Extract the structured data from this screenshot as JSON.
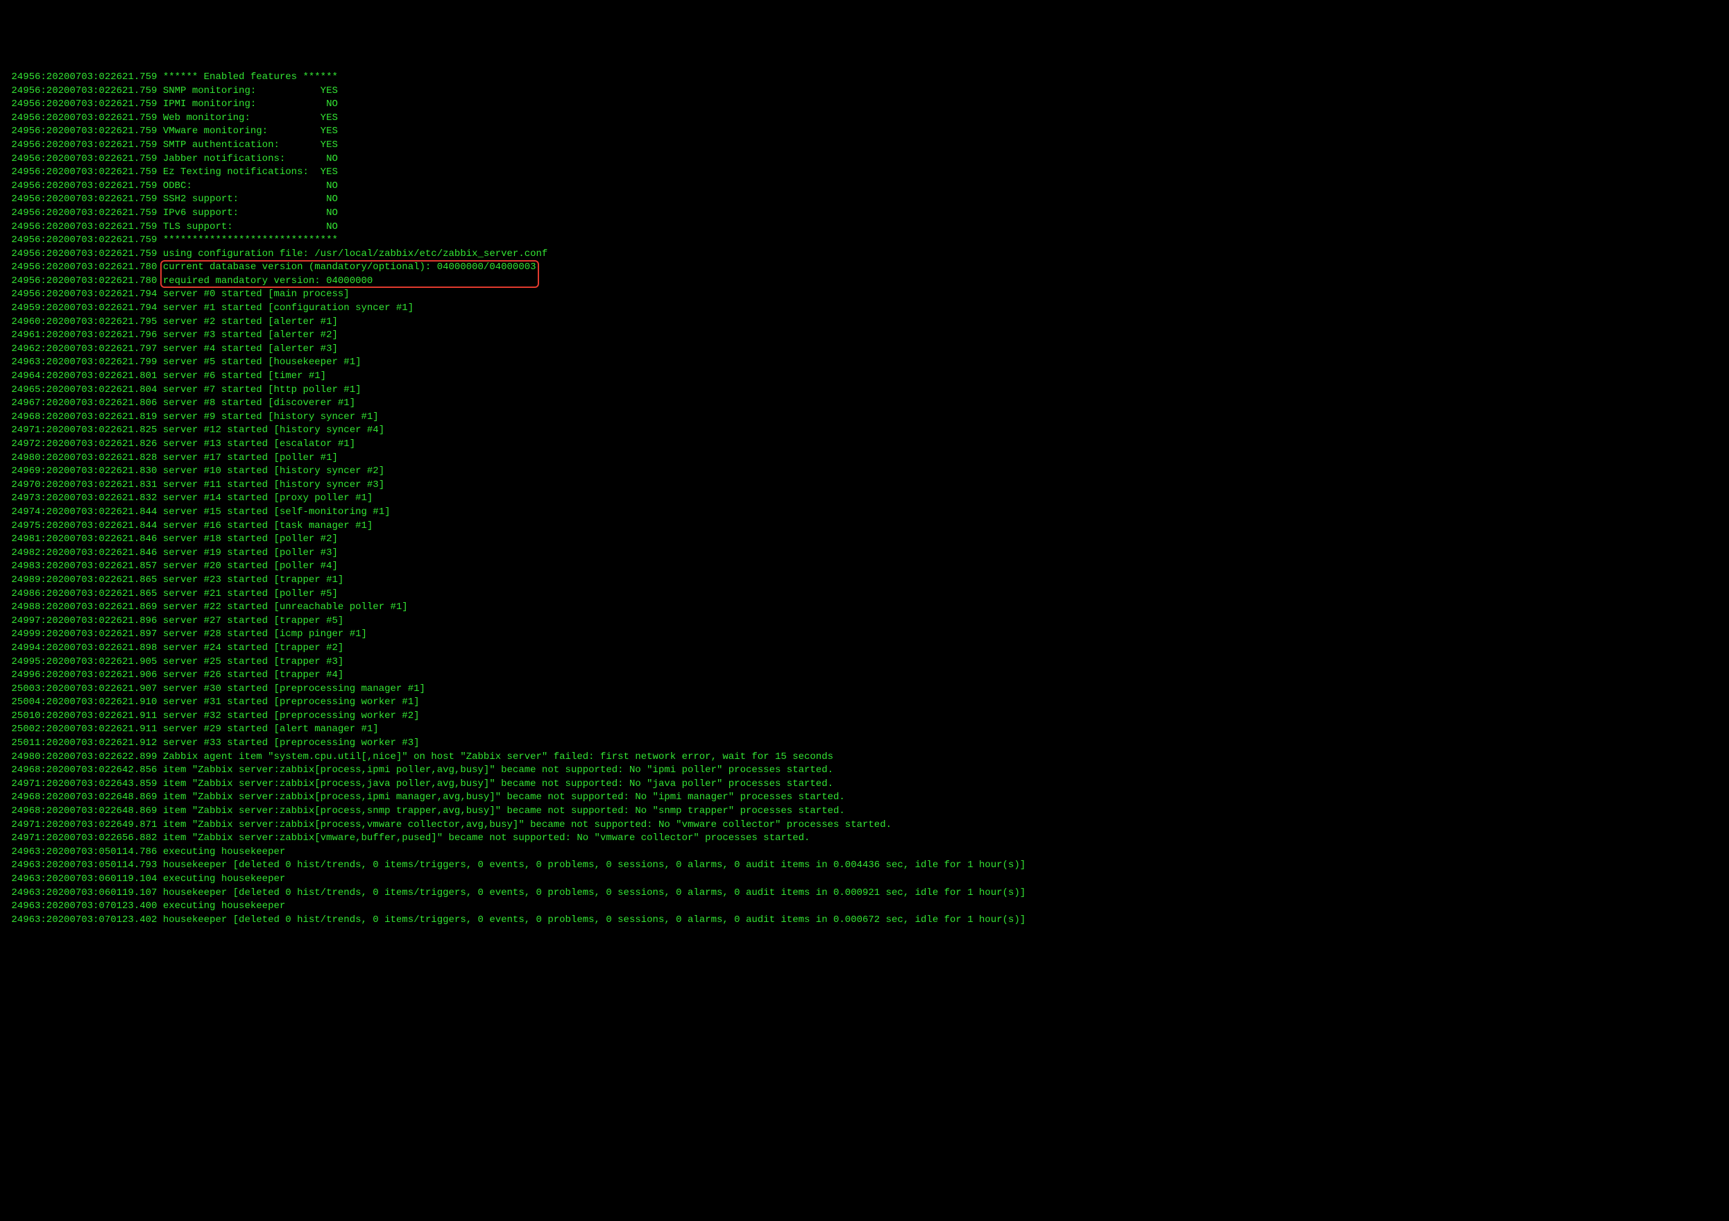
{
  "logs": [
    {
      "prefix": " 24956:20200703:022621.759 ",
      "text": "****** Enabled features ******"
    },
    {
      "prefix": " 24956:20200703:022621.759 ",
      "text": "SNMP monitoring:           YES"
    },
    {
      "prefix": " 24956:20200703:022621.759 ",
      "text": "IPMI monitoring:            NO"
    },
    {
      "prefix": " 24956:20200703:022621.759 ",
      "text": "Web monitoring:            YES"
    },
    {
      "prefix": " 24956:20200703:022621.759 ",
      "text": "VMware monitoring:         YES"
    },
    {
      "prefix": " 24956:20200703:022621.759 ",
      "text": "SMTP authentication:       YES"
    },
    {
      "prefix": " 24956:20200703:022621.759 ",
      "text": "Jabber notifications:       NO"
    },
    {
      "prefix": " 24956:20200703:022621.759 ",
      "text": "Ez Texting notifications:  YES"
    },
    {
      "prefix": " 24956:20200703:022621.759 ",
      "text": "ODBC:                       NO"
    },
    {
      "prefix": " 24956:20200703:022621.759 ",
      "text": "SSH2 support:               NO"
    },
    {
      "prefix": " 24956:20200703:022621.759 ",
      "text": "IPv6 support:               NO"
    },
    {
      "prefix": " 24956:20200703:022621.759 ",
      "text": "TLS support:                NO"
    },
    {
      "prefix": " 24956:20200703:022621.759 ",
      "text": "******************************"
    },
    {
      "prefix": " 24956:20200703:022621.759 ",
      "text": "using configuration file: /usr/local/zabbix/etc/zabbix_server.conf"
    },
    {
      "prefix": " 24956:20200703:022621.780 ",
      "text": "current database version (mandatory/optional): 04000000/04000003",
      "boxed": true,
      "boxstart": true
    },
    {
      "prefix": " 24956:20200703:022621.780 ",
      "text": "required mandatory version: 04000000",
      "boxed": true,
      "boxend": true
    },
    {
      "prefix": " 24956:20200703:022621.794 ",
      "text": "server #0 started [main process]"
    },
    {
      "prefix": " 24959:20200703:022621.794 ",
      "text": "server #1 started [configuration syncer #1]"
    },
    {
      "prefix": " 24960:20200703:022621.795 ",
      "text": "server #2 started [alerter #1]"
    },
    {
      "prefix": " 24961:20200703:022621.796 ",
      "text": "server #3 started [alerter #2]"
    },
    {
      "prefix": " 24962:20200703:022621.797 ",
      "text": "server #4 started [alerter #3]"
    },
    {
      "prefix": " 24963:20200703:022621.799 ",
      "text": "server #5 started [housekeeper #1]"
    },
    {
      "prefix": " 24964:20200703:022621.801 ",
      "text": "server #6 started [timer #1]"
    },
    {
      "prefix": " 24965:20200703:022621.804 ",
      "text": "server #7 started [http poller #1]"
    },
    {
      "prefix": " 24967:20200703:022621.806 ",
      "text": "server #8 started [discoverer #1]"
    },
    {
      "prefix": " 24968:20200703:022621.819 ",
      "text": "server #9 started [history syncer #1]"
    },
    {
      "prefix": " 24971:20200703:022621.825 ",
      "text": "server #12 started [history syncer #4]"
    },
    {
      "prefix": " 24972:20200703:022621.826 ",
      "text": "server #13 started [escalator #1]"
    },
    {
      "prefix": " 24980:20200703:022621.828 ",
      "text": "server #17 started [poller #1]"
    },
    {
      "prefix": " 24969:20200703:022621.830 ",
      "text": "server #10 started [history syncer #2]"
    },
    {
      "prefix": " 24970:20200703:022621.831 ",
      "text": "server #11 started [history syncer #3]"
    },
    {
      "prefix": " 24973:20200703:022621.832 ",
      "text": "server #14 started [proxy poller #1]"
    },
    {
      "prefix": " 24974:20200703:022621.844 ",
      "text": "server #15 started [self-monitoring #1]"
    },
    {
      "prefix": " 24975:20200703:022621.844 ",
      "text": "server #16 started [task manager #1]"
    },
    {
      "prefix": " 24981:20200703:022621.846 ",
      "text": "server #18 started [poller #2]"
    },
    {
      "prefix": " 24982:20200703:022621.846 ",
      "text": "server #19 started [poller #3]"
    },
    {
      "prefix": " 24983:20200703:022621.857 ",
      "text": "server #20 started [poller #4]"
    },
    {
      "prefix": " 24989:20200703:022621.865 ",
      "text": "server #23 started [trapper #1]"
    },
    {
      "prefix": " 24986:20200703:022621.865 ",
      "text": "server #21 started [poller #5]"
    },
    {
      "prefix": " 24988:20200703:022621.869 ",
      "text": "server #22 started [unreachable poller #1]"
    },
    {
      "prefix": " 24997:20200703:022621.896 ",
      "text": "server #27 started [trapper #5]"
    },
    {
      "prefix": " 24999:20200703:022621.897 ",
      "text": "server #28 started [icmp pinger #1]"
    },
    {
      "prefix": " 24994:20200703:022621.898 ",
      "text": "server #24 started [trapper #2]"
    },
    {
      "prefix": " 24995:20200703:022621.905 ",
      "text": "server #25 started [trapper #3]"
    },
    {
      "prefix": " 24996:20200703:022621.906 ",
      "text": "server #26 started [trapper #4]"
    },
    {
      "prefix": " 25003:20200703:022621.907 ",
      "text": "server #30 started [preprocessing manager #1]"
    },
    {
      "prefix": " 25004:20200703:022621.910 ",
      "text": "server #31 started [preprocessing worker #1]"
    },
    {
      "prefix": " 25010:20200703:022621.911 ",
      "text": "server #32 started [preprocessing worker #2]"
    },
    {
      "prefix": " 25002:20200703:022621.911 ",
      "text": "server #29 started [alert manager #1]"
    },
    {
      "prefix": " 25011:20200703:022621.912 ",
      "text": "server #33 started [preprocessing worker #3]"
    },
    {
      "prefix": " 24980:20200703:022622.899 ",
      "text": "Zabbix agent item \"system.cpu.util[,nice]\" on host \"Zabbix server\" failed: first network error, wait for 15 seconds"
    },
    {
      "prefix": " 24968:20200703:022642.856 ",
      "text": "item \"Zabbix server:zabbix[process,ipmi poller,avg,busy]\" became not supported: No \"ipmi poller\" processes started."
    },
    {
      "prefix": " 24971:20200703:022643.859 ",
      "text": "item \"Zabbix server:zabbix[process,java poller,avg,busy]\" became not supported: No \"java poller\" processes started."
    },
    {
      "prefix": " 24968:20200703:022648.869 ",
      "text": "item \"Zabbix server:zabbix[process,ipmi manager,avg,busy]\" became not supported: No \"ipmi manager\" processes started."
    },
    {
      "prefix": " 24968:20200703:022648.869 ",
      "text": "item \"Zabbix server:zabbix[process,snmp trapper,avg,busy]\" became not supported: No \"snmp trapper\" processes started."
    },
    {
      "prefix": " 24971:20200703:022649.871 ",
      "text": "item \"Zabbix server:zabbix[process,vmware collector,avg,busy]\" became not supported: No \"vmware collector\" processes started."
    },
    {
      "prefix": " 24971:20200703:022656.882 ",
      "text": "item \"Zabbix server:zabbix[vmware,buffer,pused]\" became not supported: No \"vmware collector\" processes started."
    },
    {
      "prefix": " 24963:20200703:050114.786 ",
      "text": "executing housekeeper"
    },
    {
      "prefix": " 24963:20200703:050114.793 ",
      "text": "housekeeper [deleted 0 hist/trends, 0 items/triggers, 0 events, 0 problems, 0 sessions, 0 alarms, 0 audit items in 0.004436 sec, idle for 1 hour(s)]"
    },
    {
      "prefix": " 24963:20200703:060119.104 ",
      "text": "executing housekeeper"
    },
    {
      "prefix": " 24963:20200703:060119.107 ",
      "text": "housekeeper [deleted 0 hist/trends, 0 items/triggers, 0 events, 0 problems, 0 sessions, 0 alarms, 0 audit items in 0.000921 sec, idle for 1 hour(s)]"
    },
    {
      "prefix": " 24963:20200703:070123.400 ",
      "text": "executing housekeeper"
    },
    {
      "prefix": " 24963:20200703:070123.402 ",
      "text": "housekeeper [deleted 0 hist/trends, 0 items/triggers, 0 events, 0 problems, 0 sessions, 0 alarms, 0 audit items in 0.000672 sec, idle for 1 hour(s)]"
    }
  ],
  "highlight_color": "#e23a2e",
  "cursor": "▌"
}
